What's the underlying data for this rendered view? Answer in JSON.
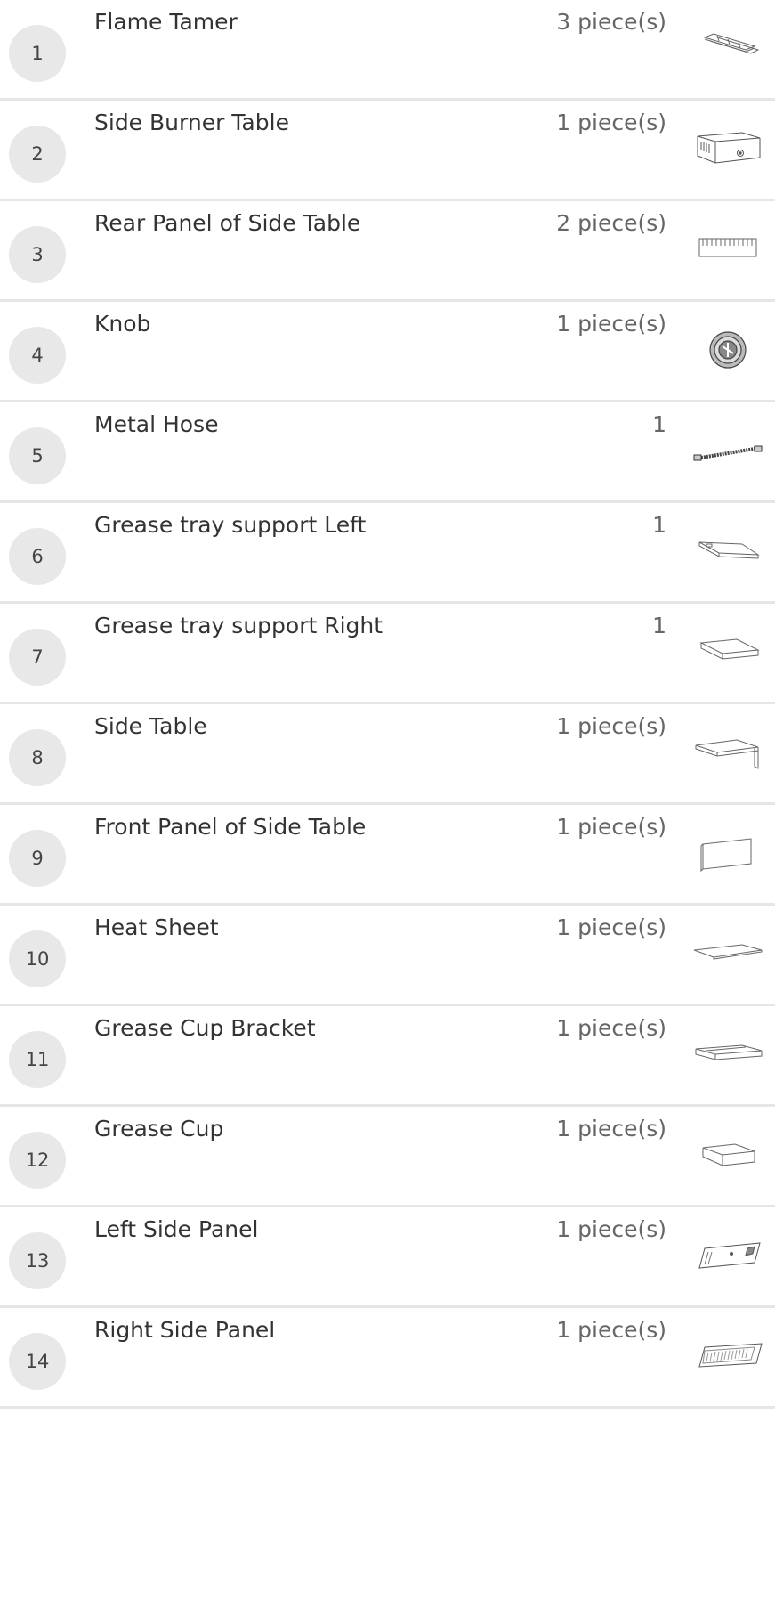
{
  "parts": [
    {
      "number": "1",
      "name": "Flame Tamer",
      "quantity": "3 piece(s)",
      "icon": "flame-tamer-icon"
    },
    {
      "number": "2",
      "name": "Side Burner Table",
      "quantity": "1 piece(s)",
      "icon": "side-burner-table-icon"
    },
    {
      "number": "3",
      "name": "Rear Panel of Side Table",
      "quantity": "2 piece(s)",
      "icon": "rear-panel-icon"
    },
    {
      "number": "4",
      "name": "Knob",
      "quantity": "1 piece(s)",
      "icon": "knob-icon"
    },
    {
      "number": "5",
      "name": "Metal Hose",
      "quantity": "1",
      "icon": "metal-hose-icon"
    },
    {
      "number": "6",
      "name": "Grease tray support Left",
      "quantity": "1",
      "icon": "grease-tray-support-left-icon"
    },
    {
      "number": "7",
      "name": "Grease tray support Right",
      "quantity": "1",
      "icon": "grease-tray-support-right-icon"
    },
    {
      "number": "8",
      "name": "Side Table",
      "quantity": "1 piece(s)",
      "icon": "side-table-icon"
    },
    {
      "number": "9",
      "name": "Front Panel of Side Table",
      "quantity": "1 piece(s)",
      "icon": "front-panel-icon"
    },
    {
      "number": "10",
      "name": "Heat Sheet",
      "quantity": "1 piece(s)",
      "icon": "heat-sheet-icon"
    },
    {
      "number": "11",
      "name": "Grease Cup Bracket",
      "quantity": "1 piece(s)",
      "icon": "grease-cup-bracket-icon"
    },
    {
      "number": "12",
      "name": "Grease Cup",
      "quantity": "1 piece(s)",
      "icon": "grease-cup-icon"
    },
    {
      "number": "13",
      "name": "Left Side Panel",
      "quantity": "1 piece(s)",
      "icon": "left-side-panel-icon"
    },
    {
      "number": "14",
      "name": "Right Side Panel",
      "quantity": "1 piece(s)",
      "icon": "right-side-panel-icon"
    }
  ]
}
